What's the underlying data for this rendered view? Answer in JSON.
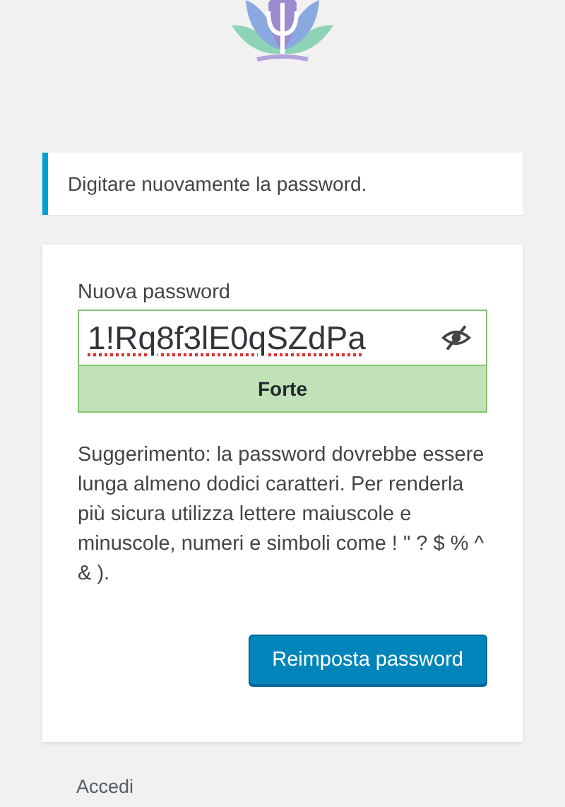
{
  "notice": {
    "text": "Digitare nuovamente la password."
  },
  "form": {
    "label": "Nuova password",
    "value": "1!Rq8f3lE0qSZdPa",
    "visible": true,
    "strength": {
      "label": "Forte",
      "kind": "strong"
    },
    "hint": "Suggerimento: la password dovrebbe essere lunga almeno dodici caratteri. Per renderla più sicura utilizza lettere maiuscole e minuscole, numeri e simboli come ! \" ? $ % ^ & ).",
    "button": "Reimposta password"
  },
  "links": [
    "Accedi"
  ]
}
